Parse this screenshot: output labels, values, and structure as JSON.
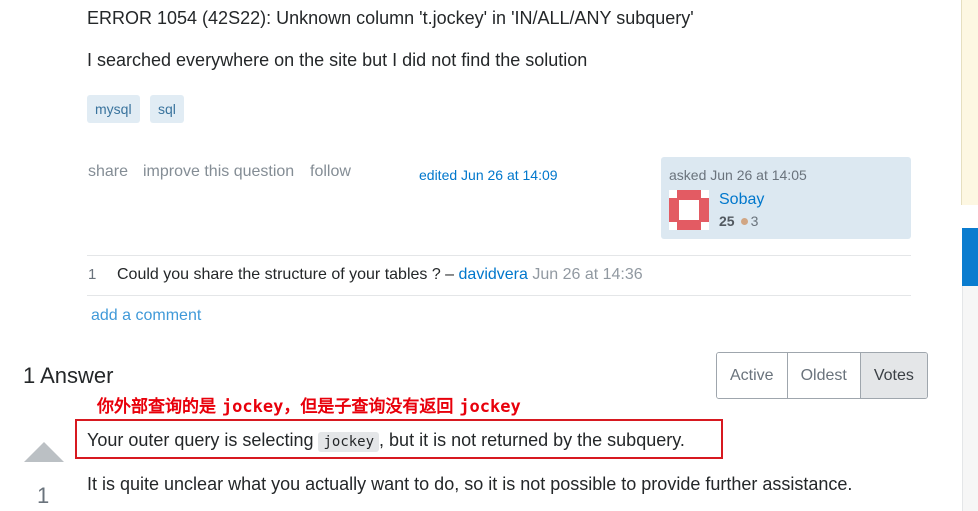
{
  "question": {
    "error_line": "ERROR 1054 (42S22): Unknown column 't.jockey' in 'IN/ALL/ANY subquery'",
    "body_line": "I searched everywhere on the site but I did not find the solution",
    "tags": [
      "mysql",
      "sql"
    ],
    "menu": [
      "share",
      "improve this question",
      "follow"
    ],
    "edited": "edited Jun 26 at 14:09",
    "owner": {
      "asked": "asked Jun 26 at 14:05",
      "name": "Sobay",
      "reputation": "25",
      "bronze": "3",
      "avatar_color": "#e35b63"
    }
  },
  "comment": {
    "score": "1",
    "text": "Could you share the structure of your tables ? – ",
    "user": "davidvera",
    "date": " Jun 26 at 14:36"
  },
  "add_comment": "add a comment",
  "answers": {
    "title": "1 Answer",
    "sort_options": [
      "Active",
      "Oldest",
      "Votes"
    ],
    "active_sort": "Votes",
    "annotation_prefix": "你外部查询的是 ",
    "annotation_kw1": "jockey",
    "annotation_mid": "，但是子查询没有返回 ",
    "annotation_kw2": "jockey",
    "line1_pre": "Your outer query is selecting ",
    "line1_code": "jockey",
    "line1_post": ", but it is not returned by the subquery.",
    "line2": "It is quite unclear what you actually want to do, so it is not possible to provide further assistance.",
    "vote_count": "1"
  },
  "colors": {
    "link": "#0077cc",
    "annotation_red": "#e8000b",
    "tag_bg": "#e1ecf4",
    "card_bg": "#dce8f1"
  }
}
